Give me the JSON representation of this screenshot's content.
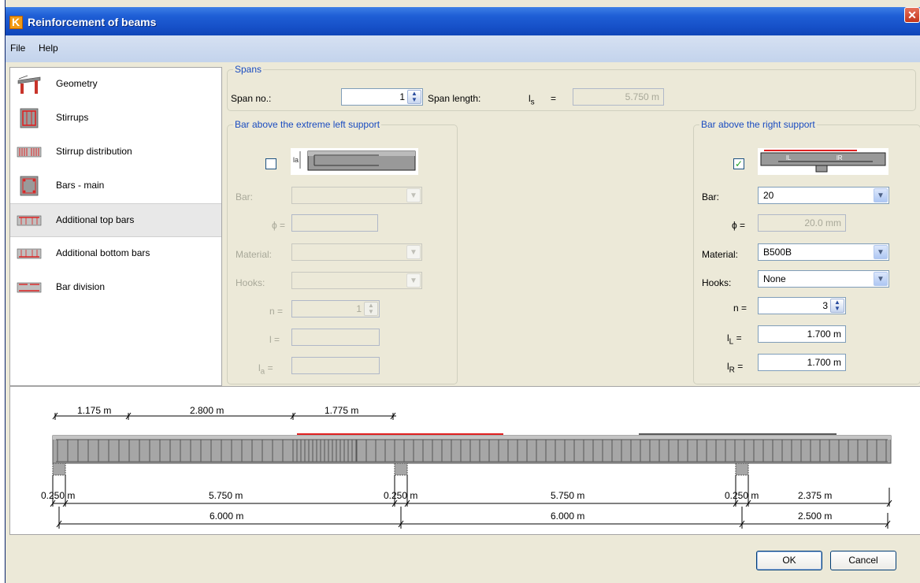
{
  "window": {
    "title": "Reinforcement of beams",
    "close_glyph": "✕",
    "logo_letter": "K"
  },
  "menu": {
    "file": "File",
    "help": "Help"
  },
  "nav": [
    {
      "label": "Geometry",
      "icon": "beam-geometry-icon"
    },
    {
      "label": "Stirrups",
      "icon": "stirrups-icon"
    },
    {
      "label": "Stirrup distribution",
      "icon": "stirrup-distribution-icon"
    },
    {
      "label": "Bars - main",
      "icon": "main-bars-icon"
    },
    {
      "label": "Additional top bars",
      "icon": "additional-top-bars-icon",
      "selected": true
    },
    {
      "label": "Additional bottom bars",
      "icon": "additional-bottom-bars-icon"
    },
    {
      "label": "Bar division",
      "icon": "bar-division-icon"
    }
  ],
  "spans": {
    "legend": "Spans",
    "span_no_label": "Span no.:",
    "span_no_value": "1",
    "span_length_label": "Span length:",
    "ls_symbol": "l",
    "ls_sub": "s",
    "ls_eq": "=",
    "ls_value": "5.750 m"
  },
  "left_support": {
    "legend": "Bar above the extreme left support",
    "checked": false,
    "bar_label": "Bar:",
    "phi_label": "ϕ =",
    "material_label": "Material:",
    "hooks_label": "Hooks:",
    "n_label": "n =",
    "n_value": "1",
    "l_label": "l =",
    "la_label": "l",
    "la_sub": "a",
    "la_eq": "=",
    "img_la": "la"
  },
  "right_support": {
    "legend": "Bar above the right support",
    "checked": true,
    "check_glyph": "✓",
    "bar_label": "Bar:",
    "bar_value": "20",
    "phi_label": "ϕ =",
    "phi_value": "20.0 mm",
    "material_label": "Material:",
    "material_value": "B500B",
    "hooks_label": "Hooks:",
    "hooks_value": "None",
    "n_label": "n =",
    "n_value": "3",
    "lL_symbol": "l",
    "lL_sub": "L",
    "lL_eq": "=",
    "lL_value": "1.700 m",
    "lR_symbol": "l",
    "lR_sub": "R",
    "lR_eq": "=",
    "lR_value": "1.700 m",
    "img_lL": "lL",
    "img_lR": "lR"
  },
  "drawing": {
    "top_dims": [
      "1.175 m",
      "2.800 m",
      "1.775 m"
    ],
    "support_width_left": "0.250 m",
    "span1_clear": "5.750 m",
    "support_width_mid": "0.250 m",
    "span2_clear": "5.750 m",
    "support_width_right": "0.250 m",
    "overhang_clear": "2.375 m",
    "span1_total": "6.000 m",
    "span2_total": "6.000 m",
    "overhang_total": "2.500 m"
  },
  "buttons": {
    "ok": "OK",
    "cancel": "Cancel"
  },
  "colors": {
    "accent": "#1a4cc0",
    "bar_red": "#e02020",
    "title_blue": "#1650c8"
  }
}
